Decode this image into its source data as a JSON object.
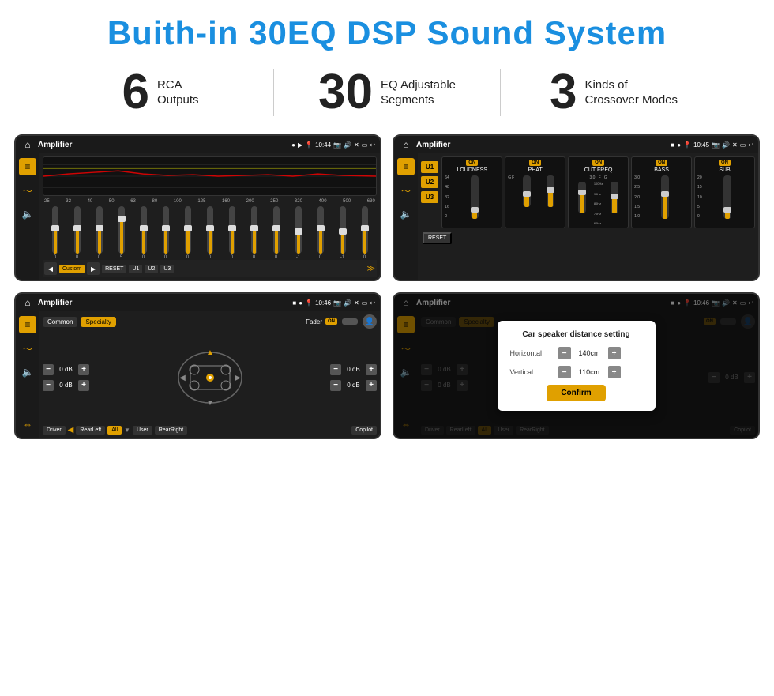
{
  "page": {
    "title": "Buith-in 30EQ DSP Sound System"
  },
  "stats": [
    {
      "id": "rca",
      "number": "6",
      "label": "RCA\nOutputs"
    },
    {
      "id": "eq",
      "number": "30",
      "label": "EQ Adjustable\nSegments"
    },
    {
      "id": "crossover",
      "number": "3",
      "label": "Kinds of\nCrossover Modes"
    }
  ],
  "screen1": {
    "title": "Amplifier",
    "time": "10:44",
    "eq_freqs": [
      "25",
      "32",
      "40",
      "50",
      "63",
      "80",
      "100",
      "125",
      "160",
      "200",
      "250",
      "320",
      "400",
      "500",
      "630"
    ],
    "eq_values": [
      "0",
      "0",
      "0",
      "5",
      "0",
      "0",
      "0",
      "0",
      "0",
      "0",
      "0",
      "-1",
      "0",
      "-1"
    ],
    "buttons": [
      "Custom",
      "RESET",
      "U1",
      "U2",
      "U3"
    ]
  },
  "screen2": {
    "title": "Amplifier",
    "time": "10:45",
    "u_buttons": [
      "U1",
      "U2",
      "U3"
    ],
    "sections": [
      "LOUDNESS",
      "PHAT",
      "CUT FREQ",
      "BASS",
      "SUB"
    ],
    "on_labels": [
      "ON",
      "ON",
      "ON",
      "ON",
      "ON"
    ],
    "reset_label": "RESET"
  },
  "screen3": {
    "title": "Amplifier",
    "time": "10:46",
    "tabs": [
      "Common",
      "Specialty"
    ],
    "fader_label": "Fader",
    "on_label": "ON",
    "db_values": [
      "0 dB",
      "0 dB",
      "0 dB",
      "0 dB"
    ],
    "bottom_buttons": [
      "Driver",
      "RearLeft",
      "All",
      "User",
      "RearRight",
      "Copilot"
    ]
  },
  "screen4": {
    "title": "Amplifier",
    "time": "10:46",
    "tabs": [
      "Common",
      "Specialty"
    ],
    "dialog": {
      "title": "Car speaker distance setting",
      "horizontal_label": "Horizontal",
      "horizontal_value": "140cm",
      "vertical_label": "Vertical",
      "vertical_value": "110cm",
      "confirm_label": "Confirm"
    },
    "db_values": [
      "0 dB",
      "0 dB"
    ],
    "bottom_buttons": [
      "Driver",
      "RearLeft",
      "All",
      "User",
      "RearRight",
      "Copilot"
    ]
  }
}
